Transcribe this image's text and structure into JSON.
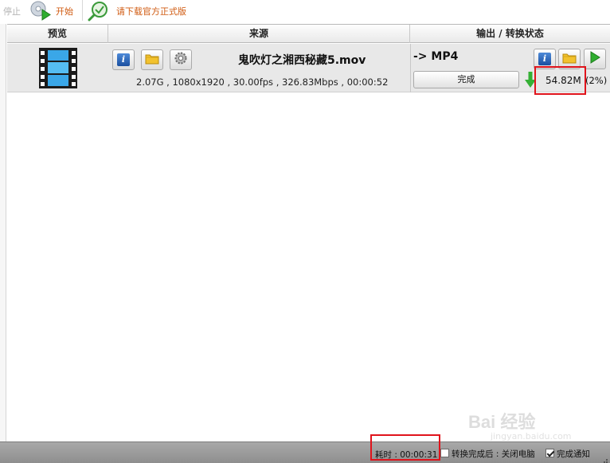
{
  "toolbar": {
    "stop_label": "停止",
    "start_label": "开始",
    "download_label": "请下载官方正式版"
  },
  "table": {
    "headers": [
      "预览",
      "来源",
      "输出 / 转换状态"
    ],
    "rows": [
      {
        "source_name": "鬼吹灯之湘西秘藏5.mov",
        "source_meta": "2.07G , 1080x1920 , 30.00fps , 326.83Mbps , 00:00:52",
        "output_format": "-> MP4",
        "status_button": "完成",
        "output_size": "54.82M",
        "progress_text": "(2%)",
        "progress": 0.02
      }
    ]
  },
  "statusbar": {
    "elapsed": "耗时 : 00:00:31",
    "shutdown_label": "转换完成后 : 关闭电脑",
    "shutdown_checked": false,
    "notify_label": "完成通知",
    "notify_checked": true
  },
  "watermark": {
    "main": "Bai 经验",
    "sub": "jingyan.baidu.com"
  },
  "colors": {
    "accent_orange": "#d05a10",
    "highlight_red": "#e0141c",
    "play_green": "#2fae2f",
    "row_bg": "#e8e8e8",
    "statusbar_bg": "#999999"
  },
  "icons": [
    "media-start-icon",
    "magnifier-download-icon",
    "film-thumbnail-icon",
    "info-icon",
    "folder-icon",
    "settings-gear-icon",
    "play-icon",
    "download-arrow-icon",
    "resize-grip-icon"
  ]
}
